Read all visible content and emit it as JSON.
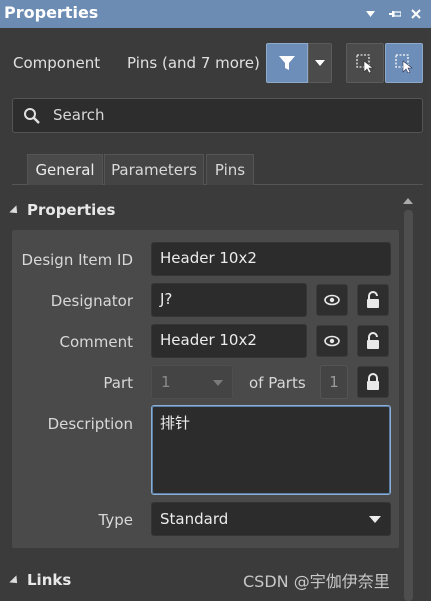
{
  "titlebar": {
    "title": "Properties"
  },
  "toolbar": {
    "component_label": "Component",
    "pins_label": "Pins (and 7 more)"
  },
  "search": {
    "placeholder": "Search"
  },
  "tabs": [
    {
      "label": "General"
    },
    {
      "label": "Parameters"
    },
    {
      "label": "Pins"
    }
  ],
  "properties_section": {
    "header": "Properties",
    "design_item_id": {
      "label": "Design Item ID",
      "value": "Header 10x2"
    },
    "designator": {
      "label": "Designator",
      "value": "J?"
    },
    "comment": {
      "label": "Comment",
      "value": "Header 10x2"
    },
    "part": {
      "label": "Part",
      "value": "1",
      "of_parts_label": "of Parts",
      "of_parts_value": "1"
    },
    "description": {
      "label": "Description",
      "value": "排针"
    },
    "type": {
      "label": "Type",
      "value": "Standard"
    }
  },
  "links_section": {
    "header": "Links"
  },
  "watermark": "CSDN @宇伽伊奈里",
  "colors": {
    "accent": "#6c8cb4",
    "background": "#3b3b3b",
    "panel": "#4a4a4a",
    "field": "#2c2c2c"
  }
}
